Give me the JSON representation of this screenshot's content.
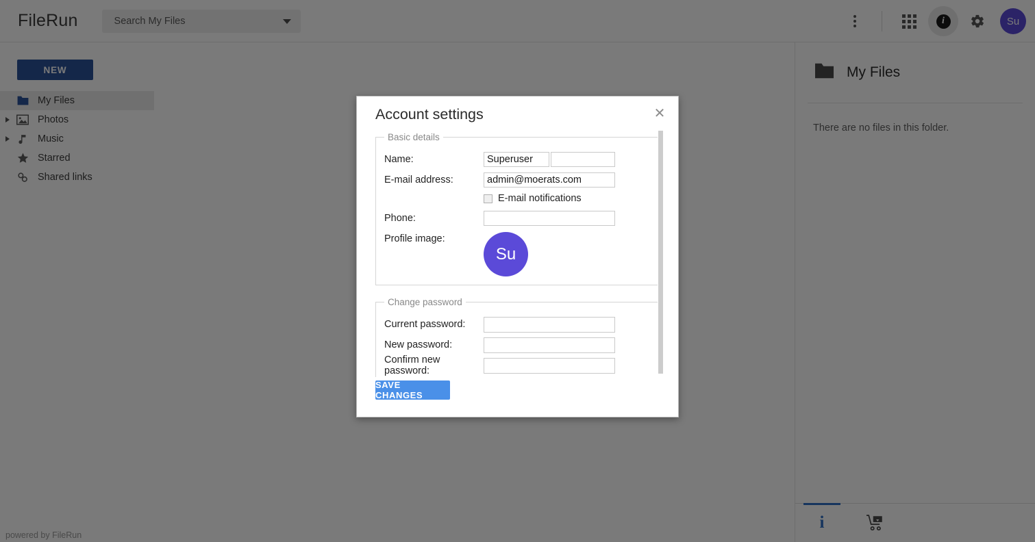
{
  "header": {
    "logo": "FileRun",
    "search": {
      "placeholder": "Search My Files"
    },
    "icons": {
      "kebab": "more-vertical-icon",
      "apps": "grid-apps-icon",
      "info": "info-icon",
      "settings": "gear-icon"
    },
    "avatar_initials": "Su"
  },
  "sidebar": {
    "new_label": "NEW",
    "items": [
      {
        "label": "My Files",
        "icon": "folder-icon",
        "selected": true,
        "expandable": false
      },
      {
        "label": "Photos",
        "icon": "image-icon",
        "selected": false,
        "expandable": true
      },
      {
        "label": "Music",
        "icon": "music-note-icon",
        "selected": false,
        "expandable": true
      },
      {
        "label": "Starred",
        "icon": "star-icon",
        "selected": false,
        "expandable": false
      },
      {
        "label": "Shared links",
        "icon": "link-chain-icon",
        "selected": false,
        "expandable": false
      }
    ],
    "footer": "powered by FileRun"
  },
  "right_panel": {
    "title": "My Files",
    "folder_icon": "folder-icon",
    "empty_message": "There are no files in this folder.",
    "tabs": [
      {
        "label": "i",
        "icon": "info-icon",
        "active": true
      },
      {
        "label": "",
        "icon": "shopping-cart-icon",
        "active": false
      }
    ]
  },
  "dialog": {
    "title": "Account settings",
    "close_icon": "close-icon",
    "basic_details": {
      "legend": "Basic details",
      "name_label": "Name:",
      "name_first": "Superuser",
      "name_last": "",
      "email_label": "E-mail address:",
      "email_value": "admin@moerats.com",
      "notifications_label": "E-mail notifications",
      "notifications_checked": false,
      "phone_label": "Phone:",
      "phone_value": "",
      "profile_image_label": "Profile image:",
      "profile_initials": "Su"
    },
    "change_password": {
      "legend": "Change password",
      "current_label": "Current password:",
      "current_value": "",
      "new_label": "New password:",
      "new_value": "",
      "confirm_label": "Confirm new password:",
      "confirm_value": ""
    },
    "save_label": "SAVE CHANGES"
  },
  "colors": {
    "accent_blue": "#4a90e8",
    "new_button_blue": "#2a5298",
    "avatar_purple": "#5b4ad8",
    "tab_active_blue": "#2f6fc4"
  }
}
